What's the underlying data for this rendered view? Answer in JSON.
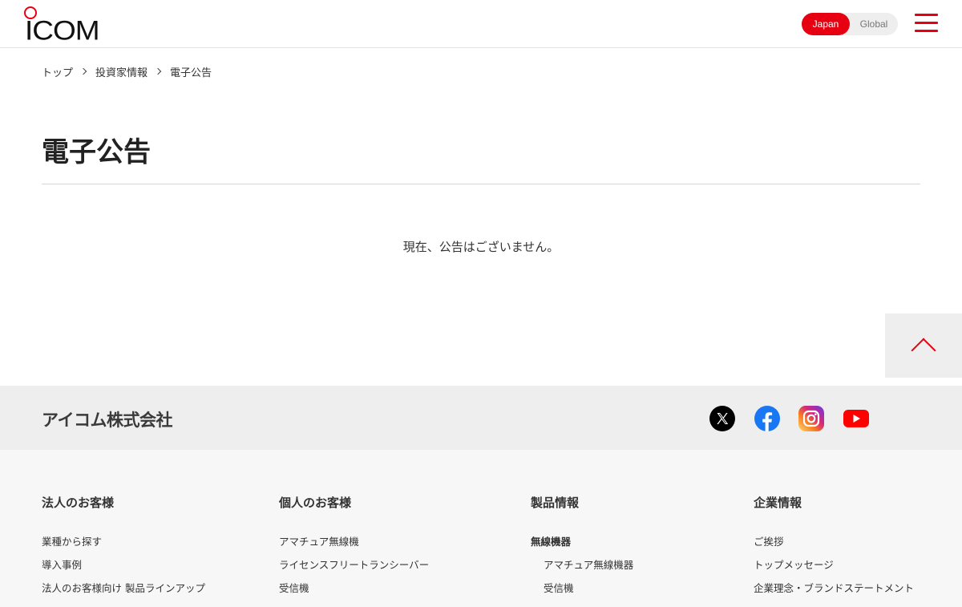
{
  "header": {
    "logo_text": "ICOM",
    "lang_japan": "Japan",
    "lang_global": "Global"
  },
  "breadcrumb": {
    "items": [
      "トップ",
      "投資家情報",
      "電子公告"
    ]
  },
  "main": {
    "title": "電子公告",
    "notice": "現在、公告はございません。"
  },
  "footer": {
    "company_name": "アイコム株式会社",
    "columns": [
      {
        "heading": "法人のお客様",
        "links": [
          "業種から探す",
          "導入事例",
          "法人のお客様向け 製品ラインアップ"
        ]
      },
      {
        "heading": "個人のお客様",
        "links": [
          "アマチュア無線機",
          "ライセンスフリートランシーバー",
          "受信機"
        ]
      },
      {
        "heading": "製品情報",
        "links": [
          "無線機器",
          "アマチュア無線機器",
          "受信機"
        ]
      },
      {
        "heading": "企業情報",
        "links": [
          "ご挨拶",
          "トップメッセージ",
          "企業理念・ブランドステートメント"
        ]
      }
    ]
  },
  "colors": {
    "brand_red": "#e60012",
    "footer_band": "#eeeeee",
    "footer_nav": "#f7f7f7"
  }
}
